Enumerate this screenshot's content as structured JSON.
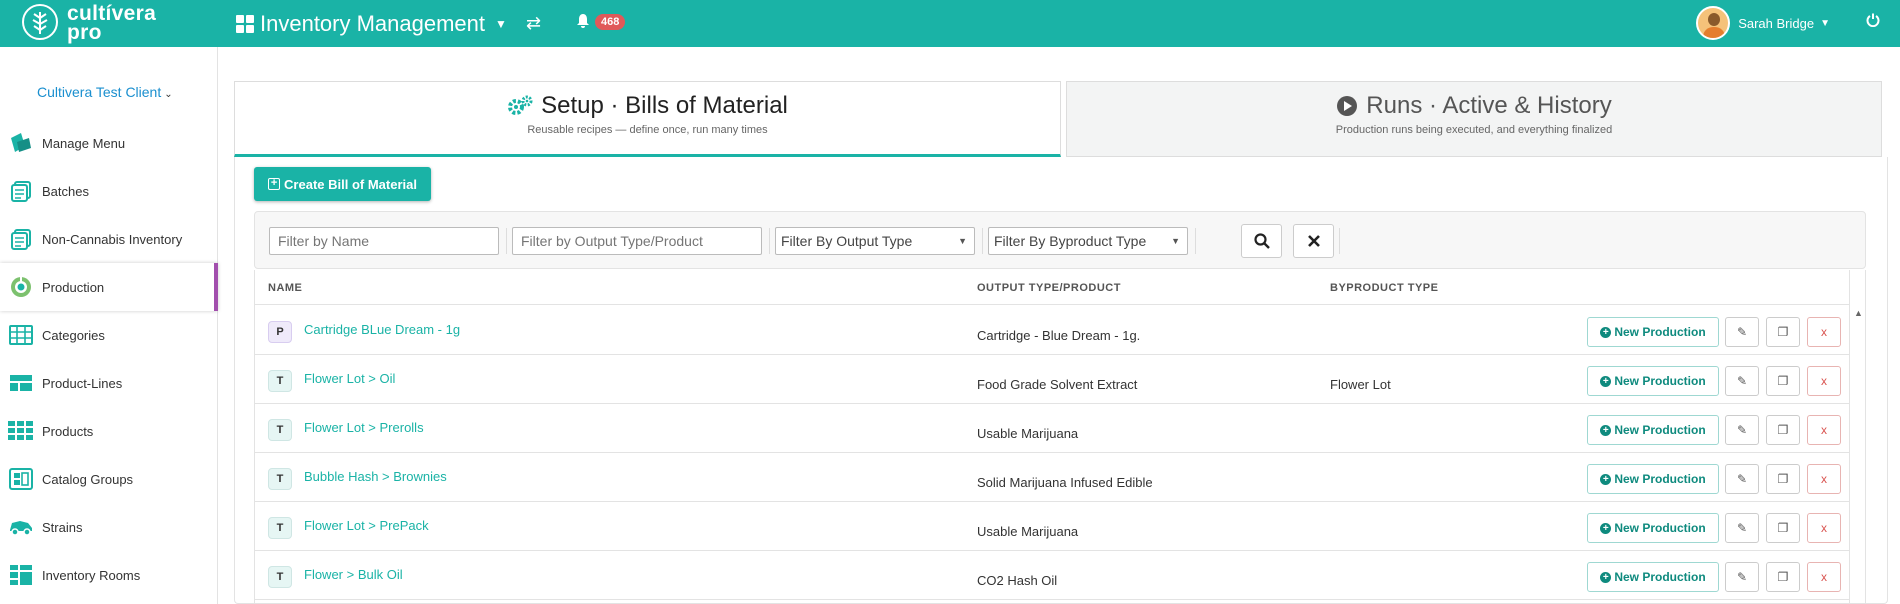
{
  "header": {
    "brand_line1": "cultívera",
    "brand_line2": "pro",
    "app_title": "Inventory Management",
    "notification_count": "468",
    "user_name": "Sarah Bridge"
  },
  "sidebar": {
    "client": "Cultivera Test Client",
    "items": [
      {
        "label": "Manage Menu",
        "icon": "menu-book-icon"
      },
      {
        "label": "Batches",
        "icon": "batches-icon"
      },
      {
        "label": "Non-Cannabis Inventory",
        "icon": "inventory-icon"
      },
      {
        "label": "Production",
        "icon": "production-icon"
      },
      {
        "label": "Categories",
        "icon": "categories-icon"
      },
      {
        "label": "Product-Lines",
        "icon": "product-lines-icon"
      },
      {
        "label": "Products",
        "icon": "products-icon"
      },
      {
        "label": "Catalog Groups",
        "icon": "catalog-groups-icon"
      },
      {
        "label": "Strains",
        "icon": "strains-icon"
      },
      {
        "label": "Inventory Rooms",
        "icon": "inventory-rooms-icon"
      }
    ]
  },
  "tabs": [
    {
      "title": "Setup · Bills of Material",
      "subtitle": "Reusable recipes — define once, run many times"
    },
    {
      "title": "Runs · Active & History",
      "subtitle": "Production runs being executed, and everything finalized"
    }
  ],
  "toolbar": {
    "create_label": "Create Bill of Material"
  },
  "filters": {
    "name_placeholder": "Filter by Name",
    "output_placeholder": "Filter by Output Type/Product",
    "output_type_select": "Filter By Output Type",
    "byproduct_type_select": "Filter By Byproduct Type"
  },
  "table": {
    "columns": [
      "NAME",
      "OUTPUT TYPE/PRODUCT",
      "BYPRODUCT TYPE"
    ],
    "new_production_label": "New Production",
    "rows": [
      {
        "badge": "P",
        "name": "Cartridge BLue Dream - 1g",
        "output": "Cartridge - Blue Dream - 1g.",
        "byproduct": ""
      },
      {
        "badge": "T",
        "name": "Flower Lot > Oil",
        "output": "Food Grade Solvent Extract",
        "byproduct": "Flower Lot"
      },
      {
        "badge": "T",
        "name": "Flower Lot > Prerolls",
        "output": "Usable Marijuana",
        "byproduct": ""
      },
      {
        "badge": "T",
        "name": "Bubble Hash > Brownies",
        "output": "Solid Marijuana Infused Edible",
        "byproduct": ""
      },
      {
        "badge": "T",
        "name": "Flower Lot > PrePack",
        "output": "Usable Marijuana",
        "byproduct": ""
      },
      {
        "badge": "T",
        "name": "Flower > Bulk Oil",
        "output": "CO2 Hash Oil",
        "byproduct": ""
      }
    ]
  },
  "colors": {
    "accent": "#1ab3a6",
    "active_marker": "#a24fad",
    "badge_red": "#e05959"
  }
}
